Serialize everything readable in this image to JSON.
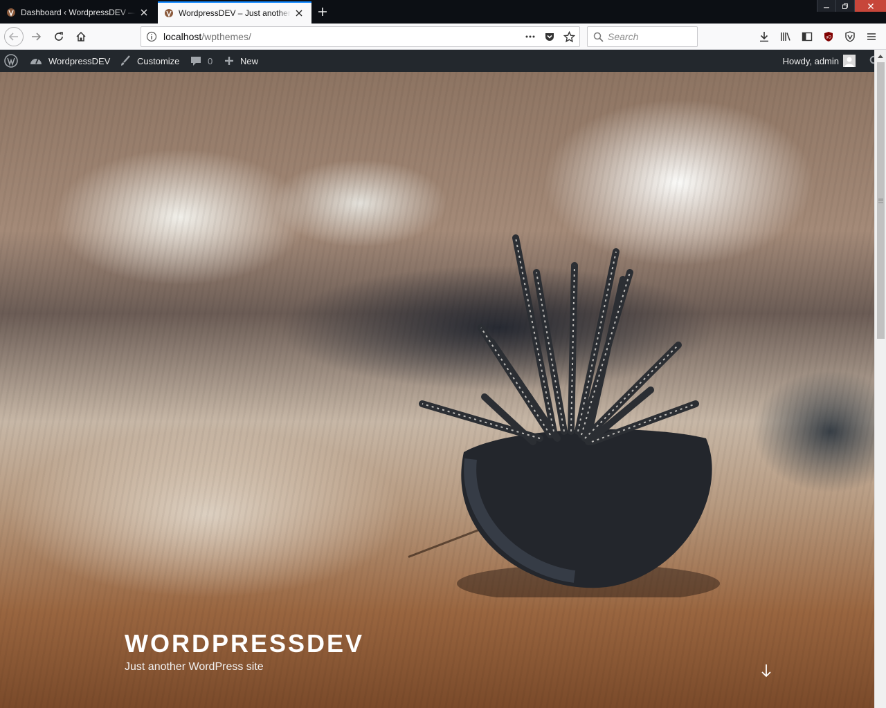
{
  "browser": {
    "tabs": [
      {
        "title": "Dashboard ‹ WordpressDEV — WordPress",
        "active": false
      },
      {
        "title": "WordpressDEV – Just another WordPress site",
        "active": true
      }
    ],
    "url": {
      "host": "localhost",
      "path": "/wpthemes/"
    },
    "search": {
      "placeholder": "Search"
    }
  },
  "adminbar": {
    "site_name": "WordpressDEV",
    "customize": "Customize",
    "comments_count": "0",
    "new_label": "New",
    "howdy": "Howdy, admin"
  },
  "site": {
    "title": "WORDPRESSDEV",
    "description": "Just another WordPress site"
  },
  "colors": {
    "adminbar_bg": "#23282d",
    "tabstrip_bg": "#0c0f14",
    "accent": "#0a84ff"
  }
}
